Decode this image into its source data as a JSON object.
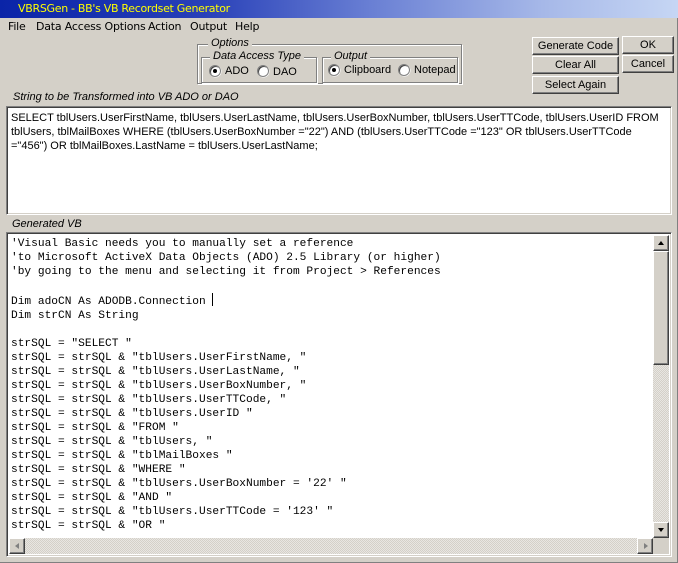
{
  "window": {
    "title": "VBRSGen - BB's VB Recordset Generator"
  },
  "menu": [
    "File",
    "Data Access Options",
    "Action",
    "Output",
    "Help"
  ],
  "options": {
    "label": "Options",
    "data_access_type": {
      "label": "Data Access Type",
      "choices": [
        {
          "label": "ADO",
          "selected": true
        },
        {
          "label": "DAO",
          "selected": false
        }
      ]
    },
    "output": {
      "label": "Output",
      "choices": [
        {
          "label": "Clipboard",
          "selected": true
        },
        {
          "label": "Notepad",
          "selected": false
        }
      ]
    }
  },
  "buttons": {
    "generate_code": "Generate Code",
    "clear_all": "Clear All",
    "select_again": "Select Again",
    "ok": "OK",
    "cancel": "Cancel"
  },
  "input_section": {
    "label": "String to be Transformed into VB ADO or DAO",
    "value": "SELECT tblUsers.UserFirstName, tblUsers.UserLastName, tblUsers.UserBoxNumber, tblUsers.UserTTCode, tblUsers.UserID FROM tblUsers, tblMailBoxes WHERE (tblUsers.UserBoxNumber =\"22\") AND (tblUsers.UserTTCode =\"123\" OR tblUsers.UserTTCode =\"456\") OR tblMailBoxes.LastName = tblUsers.UserLastName;"
  },
  "output_section": {
    "label": "Generated VB",
    "lines": [
      "'Visual Basic needs you to manually set a reference",
      "'to Microsoft ActiveX Data Objects (ADO) 2.5 Library (or higher)",
      "'by going to the menu and selecting it from Project > References",
      "",
      "Dim adoCN As ADODB.Connection ",
      "Dim strCN As String",
      "",
      "strSQL = \"SELECT \"",
      "strSQL = strSQL & \"tblUsers.UserFirstName, \"",
      "strSQL = strSQL & \"tblUsers.UserLastName, \"",
      "strSQL = strSQL & \"tblUsers.UserBoxNumber, \"",
      "strSQL = strSQL & \"tblUsers.UserTTCode, \"",
      "strSQL = strSQL & \"tblUsers.UserID \"",
      "strSQL = strSQL & \"FROM \"",
      "strSQL = strSQL & \"tblUsers, \"",
      "strSQL = strSQL & \"tblMailBoxes \"",
      "strSQL = strSQL & \"WHERE \"",
      "strSQL = strSQL & \"tblUsers.UserBoxNumber = '22' \"",
      "strSQL = strSQL & \"AND \"",
      "strSQL = strSQL & \"tblUsers.UserTTCode = '123' \"",
      "strSQL = strSQL & \"OR \""
    ],
    "caret_line": 4,
    "vertical_scroll_position": 0.0,
    "vertical_visible_fraction": 0.42,
    "horizontal_scroll_position": 0.0
  }
}
